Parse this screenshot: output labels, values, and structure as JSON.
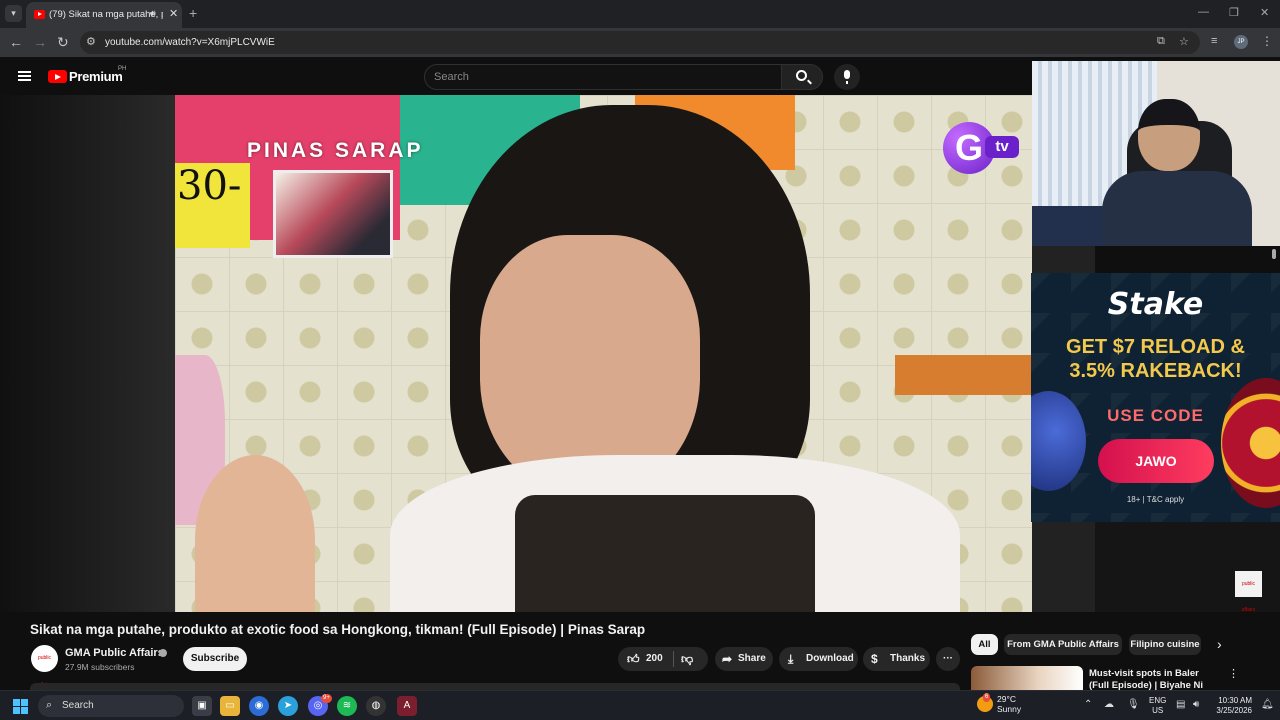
{
  "browser": {
    "tab_title": "(79) Sikat na mga putahe, p",
    "url": "youtube.com/watch?v=X6mjPLCVWiE",
    "profile_initials": "JP"
  },
  "youtube": {
    "brand": "Premium",
    "region": "PH",
    "search_placeholder": "Search"
  },
  "video": {
    "overlay_title": "PINAS SARAP",
    "sign_text": "30-",
    "network_logo_g": "G",
    "network_logo_tv": "tv",
    "title": "Sikat na mga putahe, produkto at exotic food sa Hongkong, tikman! (Full Episode) | Pinas Sarap",
    "channel": "GMA Public Affairs",
    "subscribers": "27.9M subscribers",
    "subscribe_label": "Subscribe",
    "likes": "200",
    "share_label": "Share",
    "download_label": "Download",
    "thanks_label": "Thanks",
    "corner_logo": "public affairs"
  },
  "ad": {
    "brand": "Stake",
    "headline_1": "GET $7 RELOAD &",
    "headline_2": "3.5% RAKEBACK!",
    "use_code": "USE CODE",
    "code": "JAWO",
    "fine_print": "18+ | T&C apply"
  },
  "sidebar": {
    "chips": [
      "All",
      "From GMA Public Affairs",
      "Filipino cuisine"
    ],
    "reco_title": "Must-visit spots in Baler (Full Episode) | Biyahe Ni Drew"
  },
  "taskbar": {
    "search_label": "Search",
    "temperature": "29°C",
    "weather": "Sunny",
    "lang": "ENG",
    "region": "US",
    "time": "10:30 AM",
    "date": "3/25/2026",
    "discord_badge": "9+",
    "weather_badge": "6"
  },
  "colors": {
    "youtube_red": "#ff0000",
    "background": "#0f0f0f",
    "ad_code_button": "#ff3d5f",
    "ad_headline": "#f3c94d"
  }
}
